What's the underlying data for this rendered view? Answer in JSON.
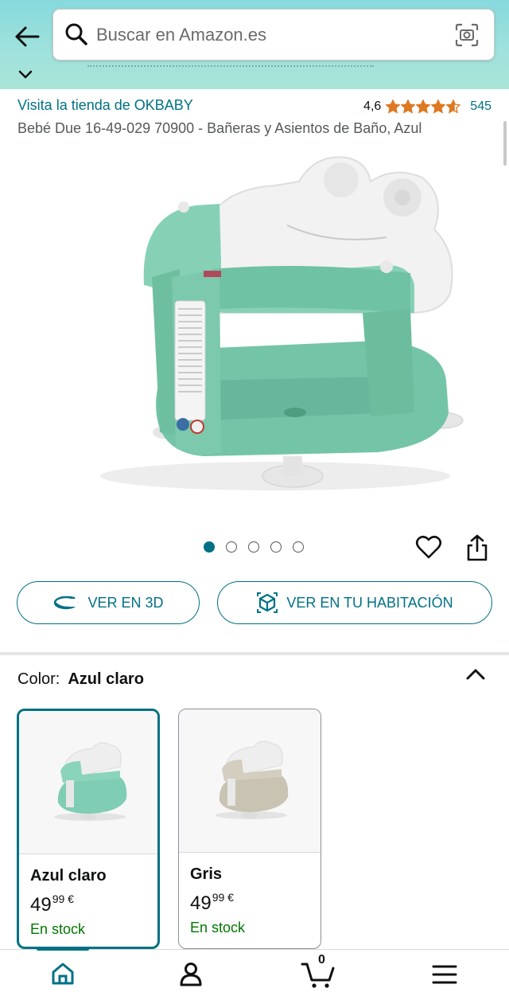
{
  "header": {
    "back_icon": "arrow-left-icon",
    "search_placeholder": "Buscar en Amazon.es",
    "search_value": "",
    "camera_icon": "camera-scan-icon"
  },
  "product": {
    "store_link": "Visita la tienda de OKBABY",
    "rating_value": "4,6",
    "rating_stars": 4.6,
    "rating_count": "545",
    "title": "Bebé Due 16-49-029 70900 - Bañeras y Asientos de Baño, Azul",
    "carousel": {
      "total": 5,
      "active": 0
    }
  },
  "actions": {
    "view_3d_label": "VER EN 3D",
    "view_room_label": "VER EN TU HABITACIÓN"
  },
  "color_section": {
    "label": "Color:",
    "selected": "Azul claro",
    "options": [
      {
        "name": "Azul claro",
        "price_whole": "49",
        "price_fraction": "99",
        "currency": "€",
        "stock": "En stock",
        "color": "#7fcdb4"
      },
      {
        "name": "Gris",
        "price_whole": "49",
        "price_fraction": "99",
        "currency": "€",
        "stock": "En stock",
        "color": "#c9c3b3"
      }
    ]
  },
  "bottom_nav": {
    "items": [
      "home-icon",
      "account-icon",
      "cart-icon",
      "menu-icon"
    ],
    "cart_count": "0"
  },
  "colors": {
    "accent": "#007185",
    "star": "#de7921",
    "stock_green": "#007600",
    "header_gradient_top": "#86d9dc"
  }
}
